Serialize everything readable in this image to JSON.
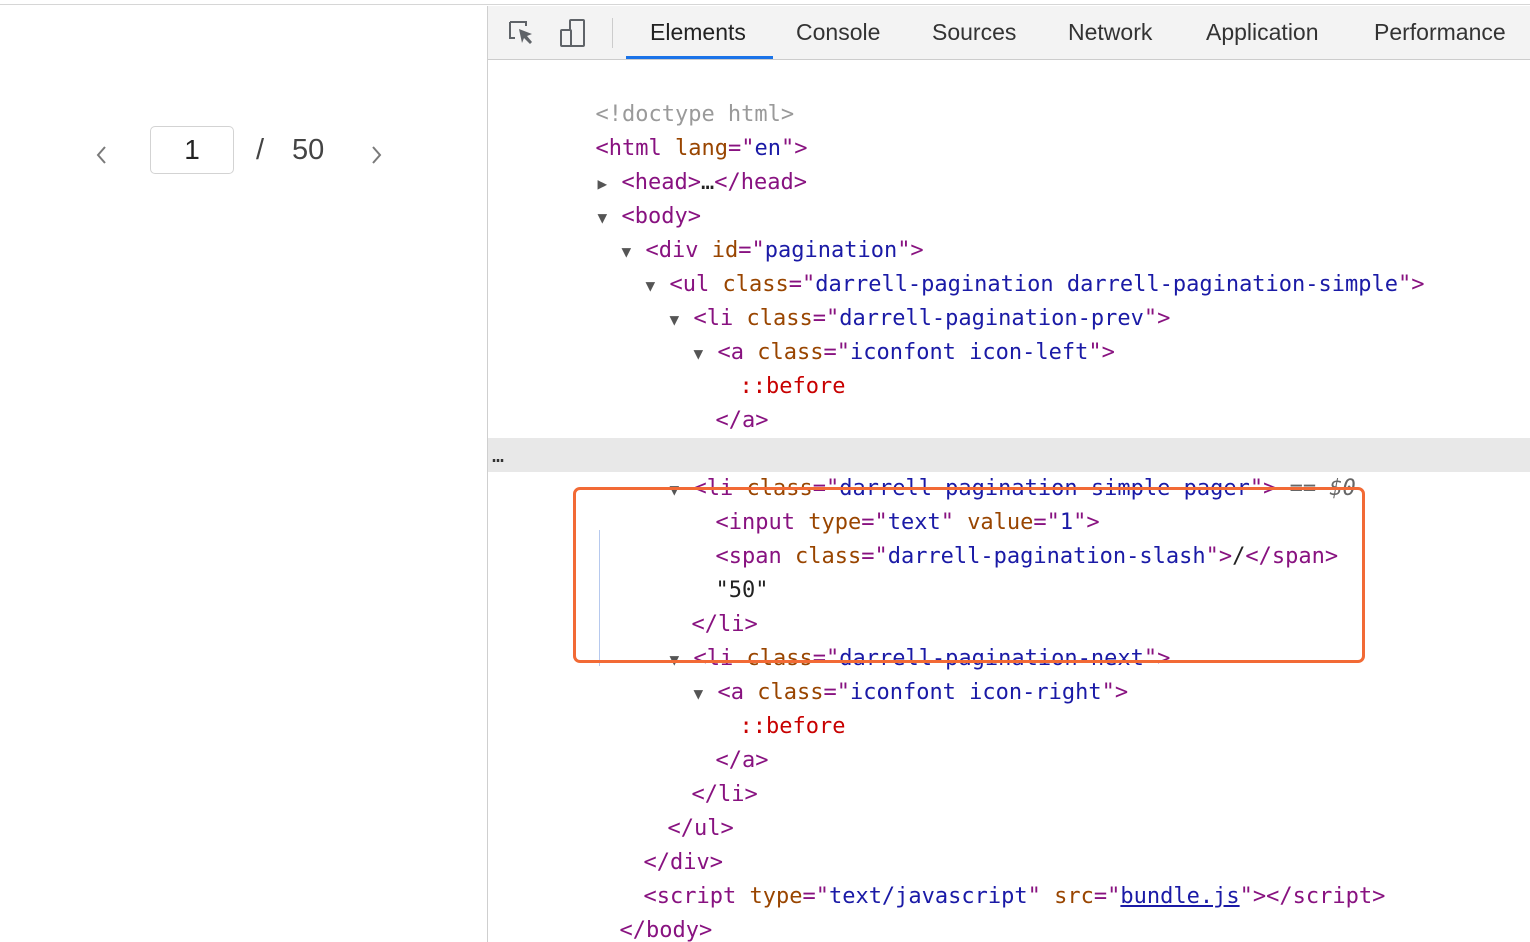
{
  "pagination": {
    "current_value": "1",
    "slash": "/",
    "total": "50"
  },
  "devtools": {
    "tabs": [
      {
        "label": "Elements",
        "active": true
      },
      {
        "label": "Console",
        "active": false
      },
      {
        "label": "Sources",
        "active": false
      },
      {
        "label": "Network",
        "active": false
      },
      {
        "label": "Application",
        "active": false
      },
      {
        "label": "Performance",
        "active": false
      }
    ],
    "toolbar_icons": [
      "inspect-element-icon",
      "device-toggle-icon"
    ],
    "tree": {
      "doctype": "<!doctype html>",
      "html_tag": "html",
      "lang_attr": "lang",
      "lang_val": "en",
      "head_collapsed": "…",
      "head_tag": "head",
      "body_tag": "body",
      "div_id_attr": "id",
      "div_id_val": "pagination",
      "ul_class_val": "darrell-pagination darrell-pagination-simple",
      "li_prev_class": "darrell-pagination-prev",
      "a_class_left": "iconfont icon-left",
      "pseudo_before": "::before",
      "li_pager_class": "darrell-pagination-simple-pager",
      "selected_marker": "== $0",
      "input_type_val": "text",
      "input_value_val": "1",
      "span_class_val": "darrell-pagination-slash",
      "span_text": "/",
      "text_node": "\"50\"",
      "li_next_class": "darrell-pagination-next",
      "a_class_right": "iconfont icon-right",
      "script_type_val": "text/javascript",
      "script_src_val": "bundle.js",
      "selected_dots": "…"
    }
  },
  "colors": {
    "highlight_border": "#f26a35",
    "active_tab_underline": "#1a73e8",
    "selected_row_bg": "#e8e8e8"
  }
}
